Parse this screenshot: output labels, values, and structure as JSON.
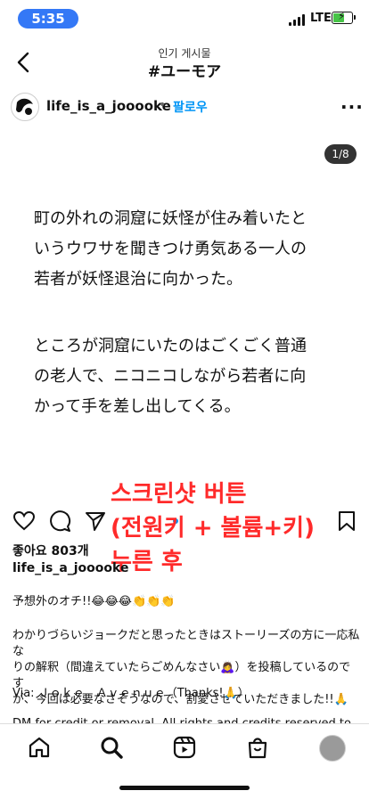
{
  "status": {
    "time": "5:35",
    "network": "LTE"
  },
  "header": {
    "subtitle": "인기 게시물",
    "title": "#ユーモア"
  },
  "post": {
    "username": "life_is_a_jooooke",
    "separator": "•",
    "follow_label": "팔로우",
    "counter": "1/8",
    "image_lines": [
      "町の外れの洞窟に妖怪が住み着いたと",
      "いうウワサを聞きつけ勇気ある一人の",
      "若者が妖怪退治に向かった。",
      "ところが洞窟にいたのはごくごく普通",
      "の老人で、ニコニコしながら若者に向",
      "かって手を差し出してくる。"
    ],
    "likes": "좋아요 803개",
    "caption_user": "life_is_a_jooooke",
    "caption_lines": [
      "予想外のオチ!!😂😂😂👏👏👏",
      "わかりづらいジョークだと思ったときはストーリーズの方に一応私な",
      "りの解釈（間違えていたらごめんなさい🙇‍♀️）を投稿しているのです",
      "が、今回は必要なさそうなので、割愛させていただきました!!🙏",
      "Via: Ｊｏｋｅ　Ａｖｅｎｕｅ（Thanks!🙏）",
      "DM for credit or removal. All rights and credits reserved to"
    ]
  },
  "overlay": {
    "lines": [
      "스크린샷 버튼",
      "(전원키 + 볼륨+키)",
      "누른 후"
    ],
    "color": "#ff2a2a"
  },
  "nav": [
    "home-icon",
    "search-icon",
    "reels-icon",
    "shop-icon",
    "profile-avatar"
  ],
  "colors": {
    "accent": "#0095f6",
    "time_pill": "#3478f6",
    "battery": "#47c447"
  }
}
